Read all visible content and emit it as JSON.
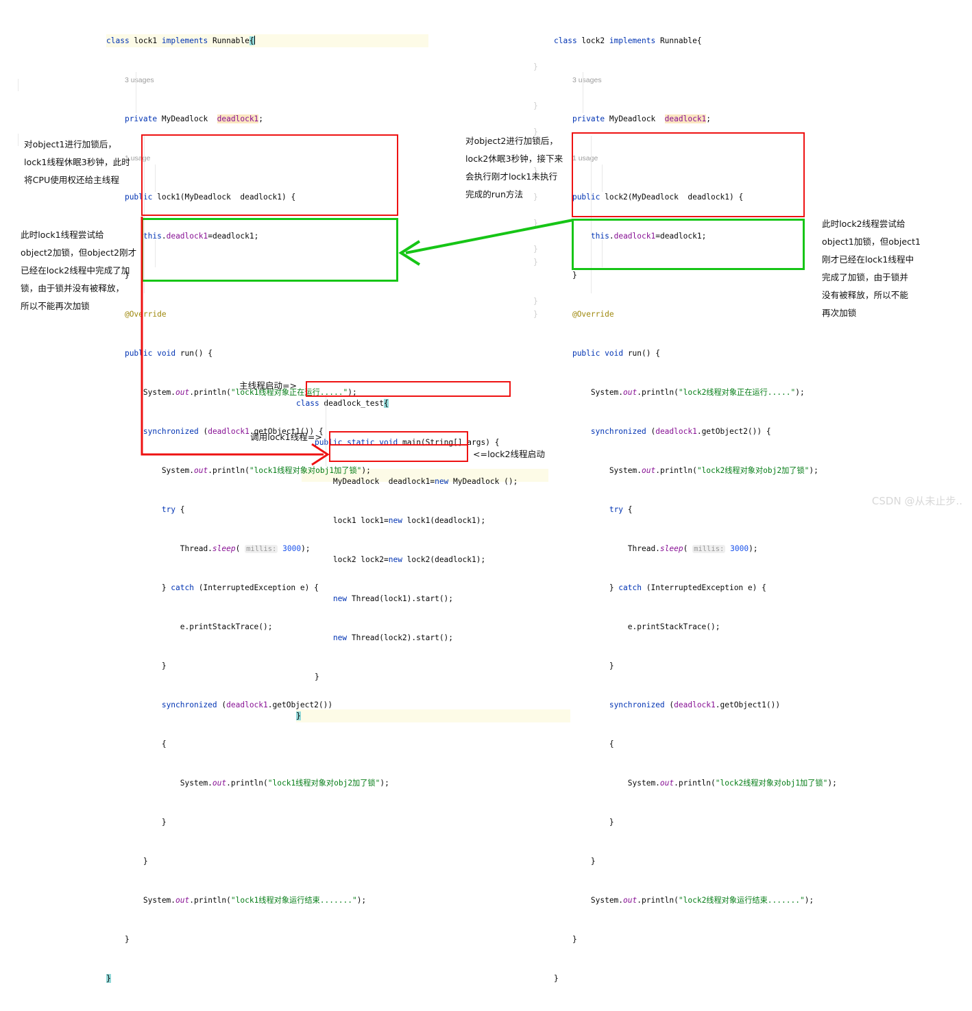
{
  "watermark": "CSDN @从未止步..",
  "left_class": {
    "title": "lock1 class",
    "lines": [
      {
        "id": "l0",
        "text": "class lock1 implements Runnable{"
      },
      {
        "id": "l1",
        "text": "3 usages"
      },
      {
        "id": "l2",
        "text": "private MyDeadlock  deadlock1;"
      },
      {
        "id": "l3",
        "text": "1 usage"
      },
      {
        "id": "l4",
        "text": "public lock1(MyDeadlock  deadlock1) {"
      },
      {
        "id": "l5",
        "text": "this.deadlock1=deadlock1;"
      },
      {
        "id": "l6",
        "text": "}"
      },
      {
        "id": "l7",
        "text": "@Override"
      },
      {
        "id": "l8",
        "text": "public void run() {"
      },
      {
        "id": "l9",
        "text": "System.out.println(\"lock1线程对象正在运行.....\");"
      },
      {
        "id": "l10",
        "text": "synchronized (deadlock1.getObject1()) {"
      },
      {
        "id": "l11",
        "text": "System.out.println(\"lock1线程对象对obj1加了锁\");"
      },
      {
        "id": "l12",
        "text": "try {"
      },
      {
        "id": "l13",
        "text": "Thread.sleep( millis: 3000);"
      },
      {
        "id": "l14",
        "text": "} catch (InterruptedException e) {"
      },
      {
        "id": "l15",
        "text": "e.printStackTrace();"
      },
      {
        "id": "l16",
        "text": "}"
      },
      {
        "id": "l17",
        "text": "synchronized (deadlock1.getObject2())"
      },
      {
        "id": "l18",
        "text": "{"
      },
      {
        "id": "l19",
        "text": "System.out.println(\"lock1线程对象对obj2加了锁\");"
      },
      {
        "id": "l20",
        "text": "}"
      },
      {
        "id": "l21",
        "text": "}"
      },
      {
        "id": "l22",
        "text": "System.out.println(\"lock1线程对象运行结束.......\");"
      },
      {
        "id": "l23",
        "text": "}"
      },
      {
        "id": "l24",
        "text": "}"
      }
    ]
  },
  "right_class": {
    "title": "lock2 class",
    "lines": [
      {
        "id": "r0",
        "text": "class lock2 implements Runnable{"
      },
      {
        "id": "r1",
        "text": "3 usages"
      },
      {
        "id": "r2",
        "text": "private MyDeadlock  deadlock1;"
      },
      {
        "id": "r3",
        "text": "1 usage"
      },
      {
        "id": "r4",
        "text": "public lock2(MyDeadlock  deadlock1) {"
      },
      {
        "id": "r5",
        "text": "this.deadlock1=deadlock1;"
      },
      {
        "id": "r6",
        "text": "}"
      },
      {
        "id": "r7",
        "text": "@Override"
      },
      {
        "id": "r8",
        "text": "public void run() {"
      },
      {
        "id": "r9",
        "text": "System.out.println(\"lock2线程对象正在运行.....\");"
      },
      {
        "id": "r10",
        "text": "synchronized (deadlock1.getObject2()) {"
      },
      {
        "id": "r11",
        "text": "System.out.println(\"lock2线程对象对obj2加了锁\");"
      },
      {
        "id": "r12",
        "text": "try {"
      },
      {
        "id": "r13",
        "text": "Thread.sleep( millis: 3000);"
      },
      {
        "id": "r14",
        "text": "} catch (InterruptedException e) {"
      },
      {
        "id": "r15",
        "text": "e.printStackTrace();"
      },
      {
        "id": "r16",
        "text": "}"
      },
      {
        "id": "r17",
        "text": "synchronized (deadlock1.getObject1())"
      },
      {
        "id": "r18",
        "text": "{"
      },
      {
        "id": "r19",
        "text": "System.out.println(\"lock2线程对象对obj1加了锁\");"
      },
      {
        "id": "r20",
        "text": "}"
      },
      {
        "id": "r21",
        "text": "}"
      },
      {
        "id": "r22",
        "text": "System.out.println(\"lock2线程对象运行结束.......\");"
      },
      {
        "id": "r23",
        "text": "}"
      },
      {
        "id": "r24",
        "text": "}"
      }
    ]
  },
  "main_class": {
    "title": "deadlock_test class",
    "lines": [
      {
        "id": "m0",
        "text": "class deadlock_test{"
      },
      {
        "id": "m1",
        "text": "public static void main(String[] args) {"
      },
      {
        "id": "m2",
        "text": "MyDeadlock  deadlock1=new MyDeadlock ();"
      },
      {
        "id": "m3",
        "text": "lock1 lock1=new lock1(deadlock1);"
      },
      {
        "id": "m4",
        "text": "lock2 lock2=new lock2(deadlock1);"
      },
      {
        "id": "m5",
        "text": "new Thread(lock1).start();"
      },
      {
        "id": "m6",
        "text": "new Thread(lock2).start();"
      },
      {
        "id": "m7",
        "text": "}"
      },
      {
        "id": "m8",
        "text": "}"
      }
    ]
  },
  "annotations": {
    "left_top": [
      "对object1进行加锁后，",
      "lock1线程休眠3秒钟，此时",
      "将CPU使用权还给主线程"
    ],
    "left_bottom": [
      "此时lock1线程尝试给",
      "object2加锁，但object2刚才",
      "已经在lock2线程中完成了加",
      "锁，由于锁并没有被释放，",
      "所以不能再次加锁"
    ],
    "mid_top": [
      "对object2进行加锁后，",
      "lock2休眠3秒钟，接下来",
      "会执行刚才lock1未执行",
      "完成的run方法"
    ],
    "right_bottom": [
      "此时lock2线程尝试给",
      "object1加锁，但object1",
      "刚才已经在lock1线程中",
      "完成了加锁，由于锁并",
      "没有被释放，所以不能",
      "再次加锁"
    ],
    "main_start": "主线程启动=>",
    "call_lock1": "调用lock1线程=>",
    "lock2_start": "<=lock2线程启动"
  },
  "colors": {
    "red_box": "#ee1111",
    "green_box": "#16c516",
    "keyword": "#0033b3",
    "string": "#067d17",
    "field": "#871094",
    "number": "#1750eb",
    "annotation": "#9e880d",
    "usage_gray": "#9d9d9d",
    "highlight_line": "#fdfbe7",
    "brace_highlight": "#93d9d9"
  }
}
